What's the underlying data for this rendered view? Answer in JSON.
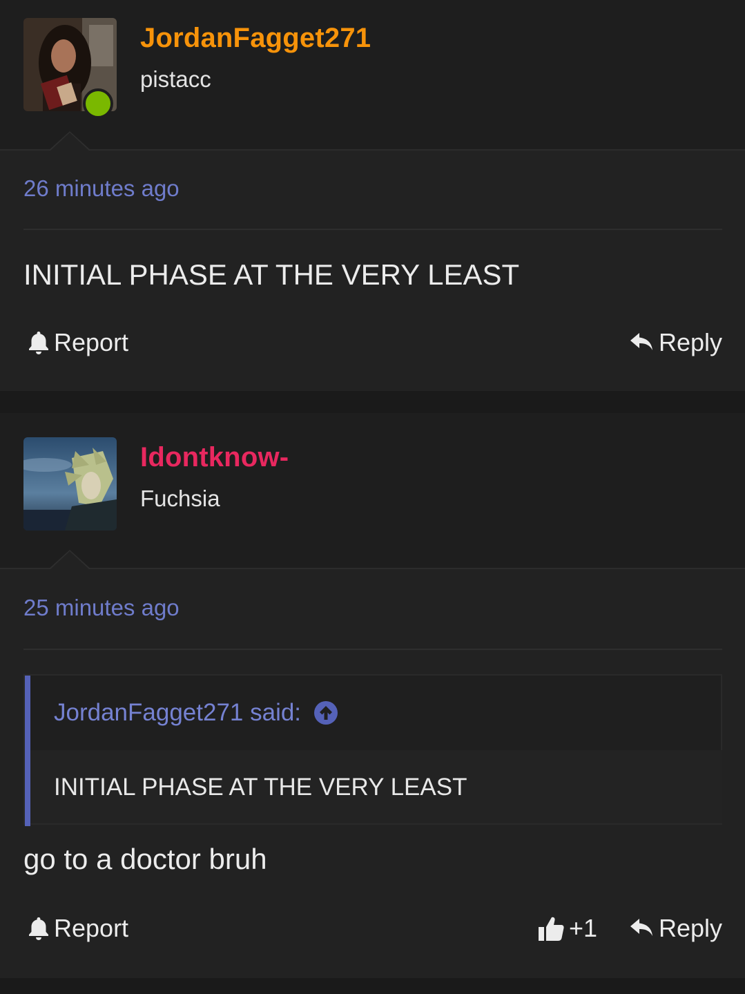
{
  "posts": [
    {
      "username": "JordanFagget271",
      "username_color": "#f7930a",
      "user_title": "pistacc",
      "online": true,
      "timestamp": "26 minutes ago",
      "body": "INITIAL PHASE AT THE VERY LEAST",
      "actions": {
        "report_label": "Report",
        "report_icon": "bell-icon",
        "reply_label": "Reply",
        "reply_icon": "reply-arrow-icon"
      }
    },
    {
      "username": "Idontknow-",
      "username_color": "#e8285f",
      "user_title": "Fuchsia",
      "timestamp": "25 minutes ago",
      "quote": {
        "author_line": "JordanFagget271 said:",
        "jump_icon": "arrow-up-circle-icon",
        "text": "INITIAL PHASE AT THE VERY LEAST"
      },
      "body": "go to a doctor bruh",
      "actions": {
        "report_label": "Report",
        "report_icon": "bell-icon",
        "like_label": "+1",
        "like_icon": "thumbs-up-icon",
        "reply_label": "Reply",
        "reply_icon": "reply-arrow-icon"
      }
    }
  ],
  "colors": {
    "link_blue": "#6f7ccb",
    "quote_accent": "#5562b8",
    "online": "#7ab800"
  }
}
